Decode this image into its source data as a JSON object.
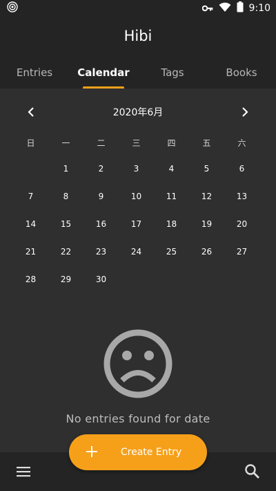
{
  "status_bar": {
    "time": "9:10",
    "icons": [
      "hotspot-icon",
      "key-icon",
      "wifi-icon",
      "battery-icon"
    ]
  },
  "app": {
    "title": "Hibi"
  },
  "tabs": [
    {
      "label": "Entries",
      "active": false
    },
    {
      "label": "Calendar",
      "active": true
    },
    {
      "label": "Tags",
      "active": false
    },
    {
      "label": "Books",
      "active": false
    }
  ],
  "calendar": {
    "month_title": "2020年6月",
    "weekdays": [
      "日",
      "一",
      "二",
      "三",
      "四",
      "五",
      "六"
    ],
    "first_day_offset": 1,
    "days": [
      "1",
      "2",
      "3",
      "4",
      "5",
      "6",
      "7",
      "8",
      "9",
      "10",
      "11",
      "12",
      "13",
      "14",
      "15",
      "16",
      "17",
      "18",
      "19",
      "20",
      "21",
      "22",
      "23",
      "24",
      "25",
      "26",
      "27",
      "28",
      "29",
      "30"
    ]
  },
  "empty_state": {
    "message": "No entries found for date",
    "icon": "sad-face-icon"
  },
  "fab": {
    "label": "Create Entry",
    "icon": "plus-icon"
  },
  "bottom_bar": {
    "icons": [
      "menu-icon",
      "search-icon"
    ]
  },
  "colors": {
    "accent": "#f6a01a",
    "background": "#2f2f2f",
    "bar": "#242424"
  }
}
